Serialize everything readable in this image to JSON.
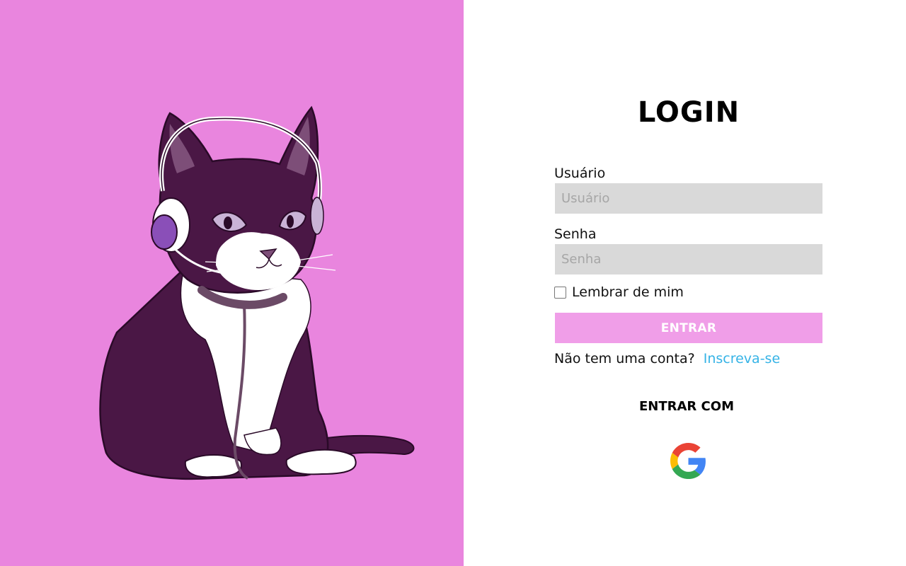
{
  "login": {
    "title": "LOGIN",
    "username": {
      "label": "Usuário",
      "placeholder": "Usuário",
      "value": ""
    },
    "password": {
      "label": "Senha",
      "placeholder": "Senha",
      "value": ""
    },
    "remember_label": "Lembrar de mim",
    "remember_checked": false,
    "submit_label": "ENTRAR",
    "signup_prompt": "Não tem uma conta?",
    "signup_link": "Inscreva-se",
    "alt_login_title": "ENTRAR COM",
    "alt_providers": [
      "google-icon"
    ]
  },
  "colors": {
    "art_background": "#e985de",
    "submit_button": "#f09ee8",
    "link": "#35b3e6",
    "input_background": "#d9d9d9"
  }
}
